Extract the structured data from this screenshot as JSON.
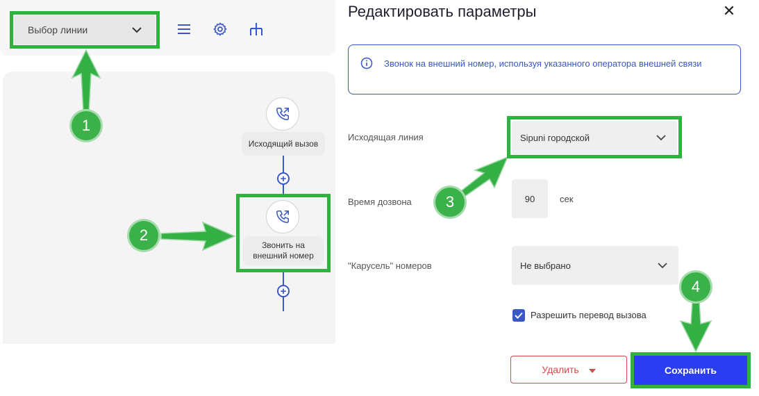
{
  "canvas": {
    "line_select": {
      "label": "Выбор линии"
    },
    "nodes": [
      {
        "label": "Исходящий вызов"
      },
      {
        "label_line1": "Звонить на",
        "label_line2": "внешний номер"
      }
    ]
  },
  "annotations": {
    "badges": [
      "1",
      "2",
      "3",
      "4"
    ]
  },
  "dialog": {
    "title": "Редактировать параметры",
    "close_glyph": "✕",
    "info_text": "Звонок на внешний номер, используя указанного оператора внешней связи",
    "outgoing_line": {
      "label": "Исходящая линия",
      "value": "Sipuni городской"
    },
    "dial_time": {
      "label": "Время дозвона",
      "value": "90",
      "unit": "сек"
    },
    "carousel": {
      "label": "\"Карусель\" номеров",
      "value": "Не выбрано"
    },
    "allow_transfer": {
      "label": "Разрешить перевод вызова",
      "checked": true
    },
    "delete_label": "Удалить",
    "save_label": "Сохранить"
  },
  "colors": {
    "accent": "#3957c6",
    "highlight": "#2fb33f",
    "badge": "#3bb14a",
    "danger": "#d94848",
    "save": "#2a3df0"
  },
  "icons": [
    "chevron-down-icon",
    "menu-icon",
    "gear-icon",
    "hierarchy-icon",
    "outgoing-call-icon",
    "plus-icon",
    "info-icon",
    "close-icon",
    "check-icon",
    "arrow-icon"
  ]
}
